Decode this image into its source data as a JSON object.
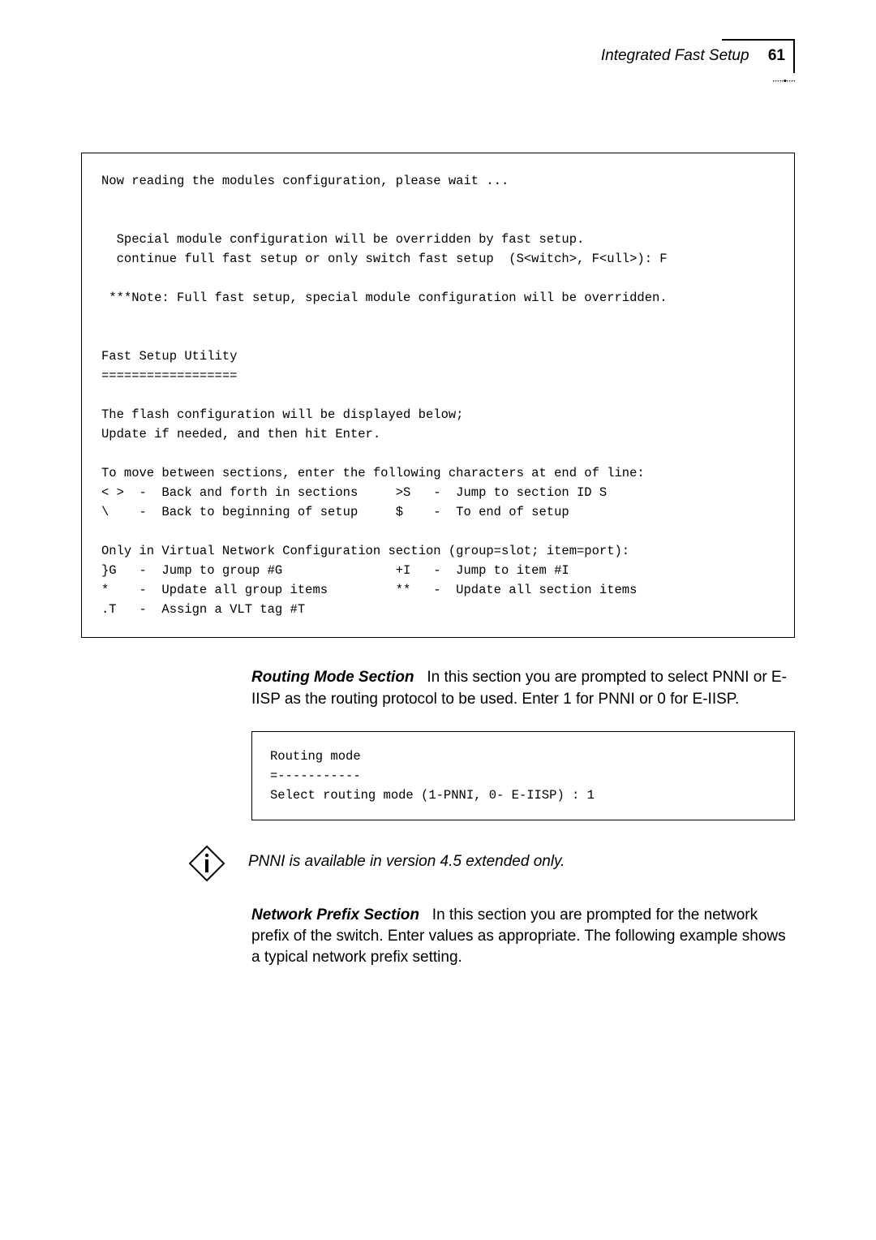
{
  "header": {
    "title": "Integrated Fast Setup",
    "page_number": "61",
    "dots": "·····•····"
  },
  "code_block_1": "Now reading the modules configuration, please wait ...\n\n\n  Special module configuration will be overridden by fast setup.\n  continue full fast setup or only switch fast setup  (S<witch>, F<ull>): F\n\n ***Note: Full fast setup, special module configuration will be overridden.\n\n\nFast Setup Utility\n==================\n\nThe flash configuration will be displayed below;\nUpdate if needed, and then hit Enter.\n\nTo move between sections, enter the following characters at end of line:\n< >  -  Back and forth in sections     >S   -  Jump to section ID S\n\\    -  Back to beginning of setup     $    -  To end of setup\n\nOnly in Virtual Network Configuration section (group=slot; item=port):\n}G   -  Jump to group #G               +I   -  Jump to item #I\n*    -  Update all group items         **   -  Update all section items\n.T   -  Assign a VLT tag #T",
  "routing_section": {
    "title": "Routing Mode Section",
    "body": "In this section you are prompted to select PNNI or E-IISP as the routing protocol to be used. Enter 1 for PNNI or 0 for E-IISP."
  },
  "code_block_2": "Routing mode\n=-----------\nSelect routing mode (1-PNNI, 0- E-IISP) : 1",
  "info_note": "PNNI is available in version 4.5 extended only.",
  "network_section": {
    "title": "Network Prefix Section",
    "body": "In this section you are prompted for the network prefix of the switch. Enter values as appropriate. The following example shows a typical network prefix setting."
  }
}
